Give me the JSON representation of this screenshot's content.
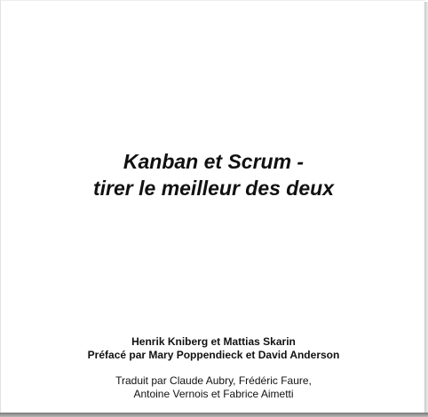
{
  "document": {
    "title_lines": [
      "Kanban et Scrum -",
      "tirer le meilleur des deux"
    ],
    "authors": "Henrik Kniberg et Mattias Skarin",
    "preface": "Préfacé par Mary Poppendieck et David Anderson",
    "translators_lines": [
      "Traduit par Claude Aubry, Frédéric Faure,",
      "Antoine Vernois et  Fabrice Aimetti"
    ]
  }
}
